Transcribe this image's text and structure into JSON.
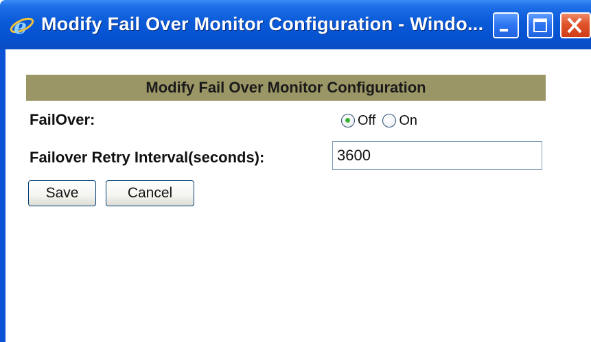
{
  "window": {
    "title": "Modify Fail Over Monitor Configuration - Windo...",
    "icon": "ie-icon",
    "controls": [
      "minimize-icon",
      "maximize-icon",
      "close-icon"
    ]
  },
  "form": {
    "header": "Modify Fail Over Monitor Configuration",
    "failover_label": "FailOver:",
    "failover_options": [
      {
        "label": "Off",
        "checked": true
      },
      {
        "label": "On",
        "checked": false
      }
    ],
    "retry_label": "Failover Retry Interval(seconds):",
    "retry_value": "3600",
    "save_label": "Save",
    "cancel_label": "Cancel"
  },
  "colors": {
    "titlebar": "#0a5ad8",
    "header_bar": "#9b9666",
    "close_button": "#e0532a"
  }
}
